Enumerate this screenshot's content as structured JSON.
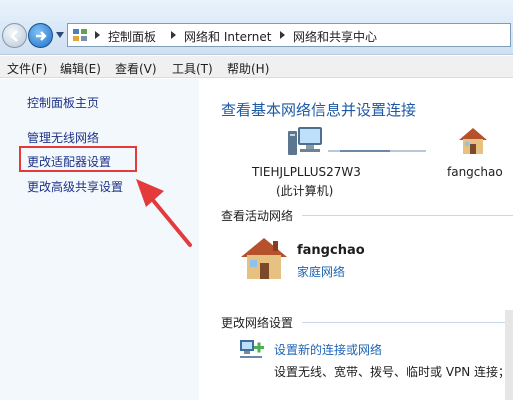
{
  "breadcrumb": [
    "控制面板",
    "网络和 Internet",
    "网络和共享中心"
  ],
  "menu": [
    "文件(F)",
    "编辑(E)",
    "查看(V)",
    "工具(T)",
    "帮助(H)"
  ],
  "sidebar": {
    "items": [
      {
        "label": "控制面板主页"
      },
      {
        "label": "管理无线网络"
      },
      {
        "label": "更改适配器设置",
        "highlighted": true
      },
      {
        "label": "更改高级共享设置"
      }
    ]
  },
  "main": {
    "title": "查看基本网络信息并设置连接",
    "computer": {
      "name": "TIEHJLPLLUS27W3",
      "sub": "(此计算机)"
    },
    "network_node": {
      "name": "fangchao"
    },
    "active_section": "查看活动网络",
    "active_network": {
      "name": "fangchao",
      "type": "家庭网络"
    },
    "change_section": "更改网络设置",
    "setup_link": "设置新的连接或网络",
    "setup_desc": "设置无线、宽带、拨号、临时或 VPN 连接；"
  },
  "colors": {
    "link": "#1e64b4",
    "highlight": "#e33b3b",
    "title": "#1e5aa6"
  },
  "icons": [
    "back-arrow-icon",
    "forward-arrow-icon",
    "control-panel-icon",
    "computer-icon",
    "house-icon",
    "network-setup-icon",
    "red-arrow-icon"
  ]
}
